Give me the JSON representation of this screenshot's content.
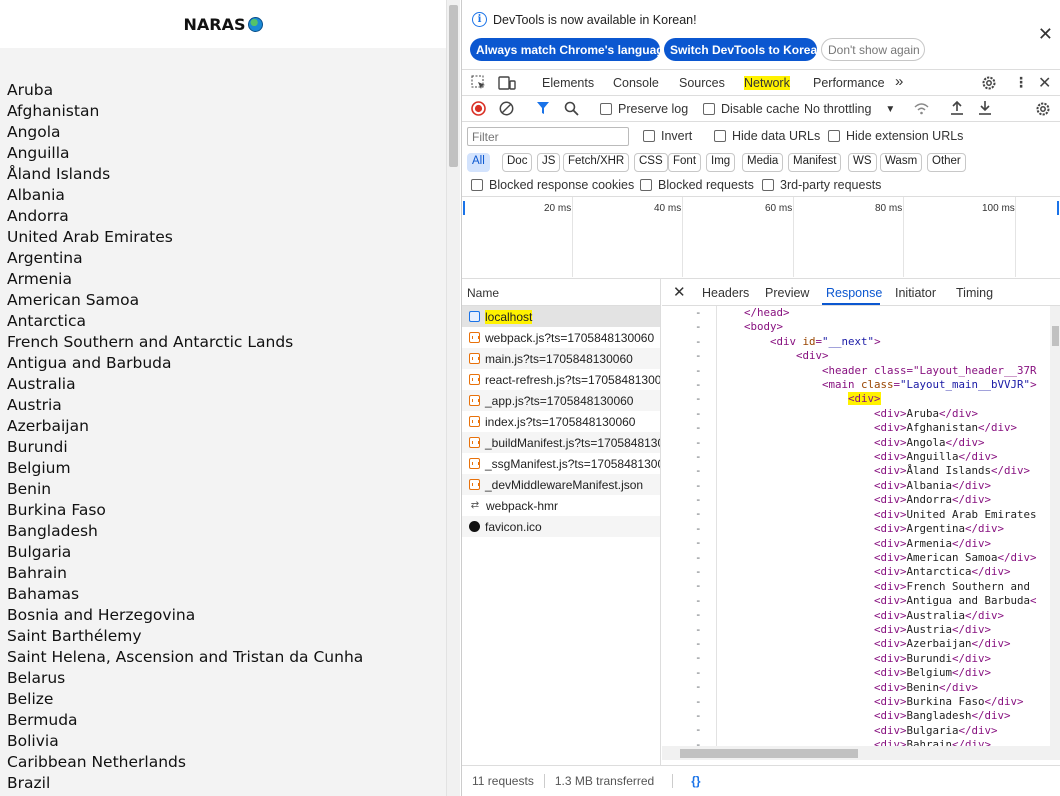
{
  "app": {
    "title": "NARAS",
    "logo_icon": "globe-icon",
    "countries": [
      "Aruba",
      "Afghanistan",
      "Angola",
      "Anguilla",
      "Åland Islands",
      "Albania",
      "Andorra",
      "United Arab Emirates",
      "Argentina",
      "Armenia",
      "American Samoa",
      "Antarctica",
      "French Southern and Antarctic Lands",
      "Antigua and Barbuda",
      "Australia",
      "Austria",
      "Azerbaijan",
      "Burundi",
      "Belgium",
      "Benin",
      "Burkina Faso",
      "Bangladesh",
      "Bulgaria",
      "Bahrain",
      "Bahamas",
      "Bosnia and Herzegovina",
      "Saint Barthélemy",
      "Saint Helena, Ascension and Tristan da Cunha",
      "Belarus",
      "Belize",
      "Bermuda",
      "Bolivia",
      "Caribbean Netherlands",
      "Brazil"
    ]
  },
  "banner": {
    "message": "DevTools is now available in Korean!",
    "buttons": [
      "Always match Chrome's language",
      "Switch DevTools to Korean",
      "Don't show again"
    ]
  },
  "tabs": {
    "items": [
      "Elements",
      "Console",
      "Sources",
      "Network",
      "Performance"
    ],
    "active": "Network",
    "more": "»"
  },
  "toolbar": {
    "preserve_log": "Preserve log",
    "disable_cache": "Disable cache",
    "throttling": "No throttling"
  },
  "filter": {
    "placeholder": "Filter",
    "invert": "Invert",
    "hide_data_urls": "Hide data URLs",
    "hide_extension_urls": "Hide extension URLs",
    "types": [
      "All",
      "Doc",
      "JS",
      "Fetch/XHR",
      "CSS",
      "Font",
      "Img",
      "Media",
      "Manifest",
      "WS",
      "Wasm",
      "Other"
    ],
    "active_type": "All",
    "blocked_response_cookies": "Blocked response cookies",
    "blocked_requests": "Blocked requests",
    "third_party": "3rd-party requests"
  },
  "timeline": {
    "labels": [
      "20 ms",
      "40 ms",
      "60 ms",
      "80 ms",
      "100 ms"
    ]
  },
  "requests": {
    "header": "Name",
    "items": [
      {
        "name": "localhost",
        "type": "doc"
      },
      {
        "name": "webpack.js?ts=1705848130060",
        "type": "js"
      },
      {
        "name": "main.js?ts=1705848130060",
        "type": "js"
      },
      {
        "name": "react-refresh.js?ts=1705848130060",
        "type": "js"
      },
      {
        "name": "_app.js?ts=1705848130060",
        "type": "js"
      },
      {
        "name": "index.js?ts=1705848130060",
        "type": "js"
      },
      {
        "name": "_buildManifest.js?ts=1705848130060",
        "type": "js"
      },
      {
        "name": "_ssgManifest.js?ts=1705848130060",
        "type": "js"
      },
      {
        "name": "_devMiddlewareManifest.json",
        "type": "js"
      },
      {
        "name": "webpack-hmr",
        "type": "ws"
      },
      {
        "name": "favicon.ico",
        "type": "fav"
      }
    ]
  },
  "detail": {
    "tabs": [
      "Headers",
      "Preview",
      "Response",
      "Initiator",
      "Timing"
    ],
    "active": "Response",
    "code_lines": [
      "</head>",
      "<body>",
      "    <div id=\"__next\">",
      "        <div>",
      "            <header class=\"Layout_header__37R",
      "            <main class=\"Layout_main__bVVJR\">",
      "                <div>",
      "                    <div>Aruba</div>",
      "                    <div>Afghanistan</div>",
      "                    <div>Angola</div>",
      "                    <div>Anguilla</div>",
      "                    <div>Åland Islands</div>",
      "                    <div>Albania</div>",
      "                    <div>Andorra</div>",
      "                    <div>United Arab Emirates",
      "                    <div>Argentina</div>",
      "                    <div>Armenia</div>",
      "                    <div>American Samoa</div>",
      "                    <div>Antarctica</div>",
      "                    <div>French Southern and",
      "                    <div>Antigua and Barbuda<",
      "                    <div>Australia</div>",
      "                    <div>Austria</div>",
      "                    <div>Azerbaijan</div>",
      "                    <div>Burundi</div>",
      "                    <div>Belgium</div>",
      "                    <div>Benin</div>",
      "                    <div>Burkina Faso</div>",
      "                    <div>Bangladesh</div>",
      "                    <div>Bulgaria</div>",
      "                    <div>Bahrain</div>"
    ],
    "gutter_mark": "-"
  },
  "status": {
    "requests": "11 requests",
    "transferred": "1.3 MB transferred",
    "format_icon": "{}"
  }
}
